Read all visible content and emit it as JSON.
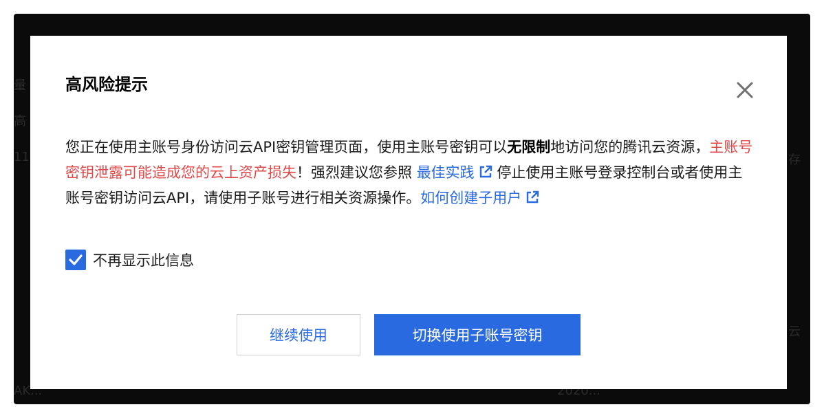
{
  "background": {
    "fragments": [
      "量",
      "高",
      "11",
      "存",
      "云",
      "AK...",
      "2020..."
    ]
  },
  "dialog": {
    "title": "高风险提示",
    "close_icon": "close-icon",
    "message": {
      "part1": "您正在使用主账号身份访问云API密钥管理页面，使用主账号密钥可以",
      "strong": "无限制",
      "part2": "地访问您的腾讯云资源，",
      "danger": "主账号密钥泄露可能造成您的云上资产损失",
      "part3": "！强烈建议您参照",
      "link1": "最佳实践",
      "part4": "停止使用主账号登录控制台或者使用主账号密钥访问云API，请使用子账号进行相关资源操作。",
      "link2": "如何创建子用户"
    },
    "checkbox": {
      "label": "不再显示此信息",
      "checked": true
    },
    "buttons": {
      "continue_label": "继续使用",
      "switch_label": "切换使用子账号密钥"
    }
  },
  "colors": {
    "accent": "#2a6ae0",
    "danger": "#e04848",
    "overlay": "#0b0b0b"
  }
}
